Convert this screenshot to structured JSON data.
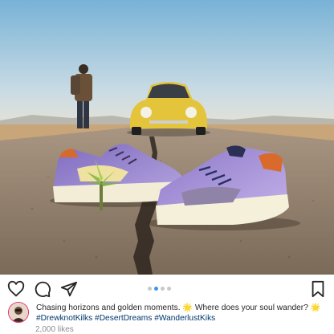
{
  "post": {
    "photo": {
      "description_icon": "photo-sneakers-desert-road",
      "colors": {
        "sky_top": "#7fb6d8",
        "sky_bottom": "#d9e6ea",
        "road": "#8c7a66",
        "car": "#e3c43b",
        "shoe": "#9a86c8"
      }
    },
    "actions": {
      "like_icon": "heart-icon",
      "comment_icon": "comment-icon",
      "share_icon": "paper-plane-icon",
      "save_icon": "bookmark-icon"
    },
    "carousel": {
      "count": 4,
      "active_index": 1
    },
    "caption": {
      "text": "Chasing horizons and golden moments. 🌟 Where does your soul wander? 🌟",
      "hashtags": "#DrewknotKilks #DesertDreams #WanderlustKiks"
    },
    "likes": "2,000 likes"
  }
}
